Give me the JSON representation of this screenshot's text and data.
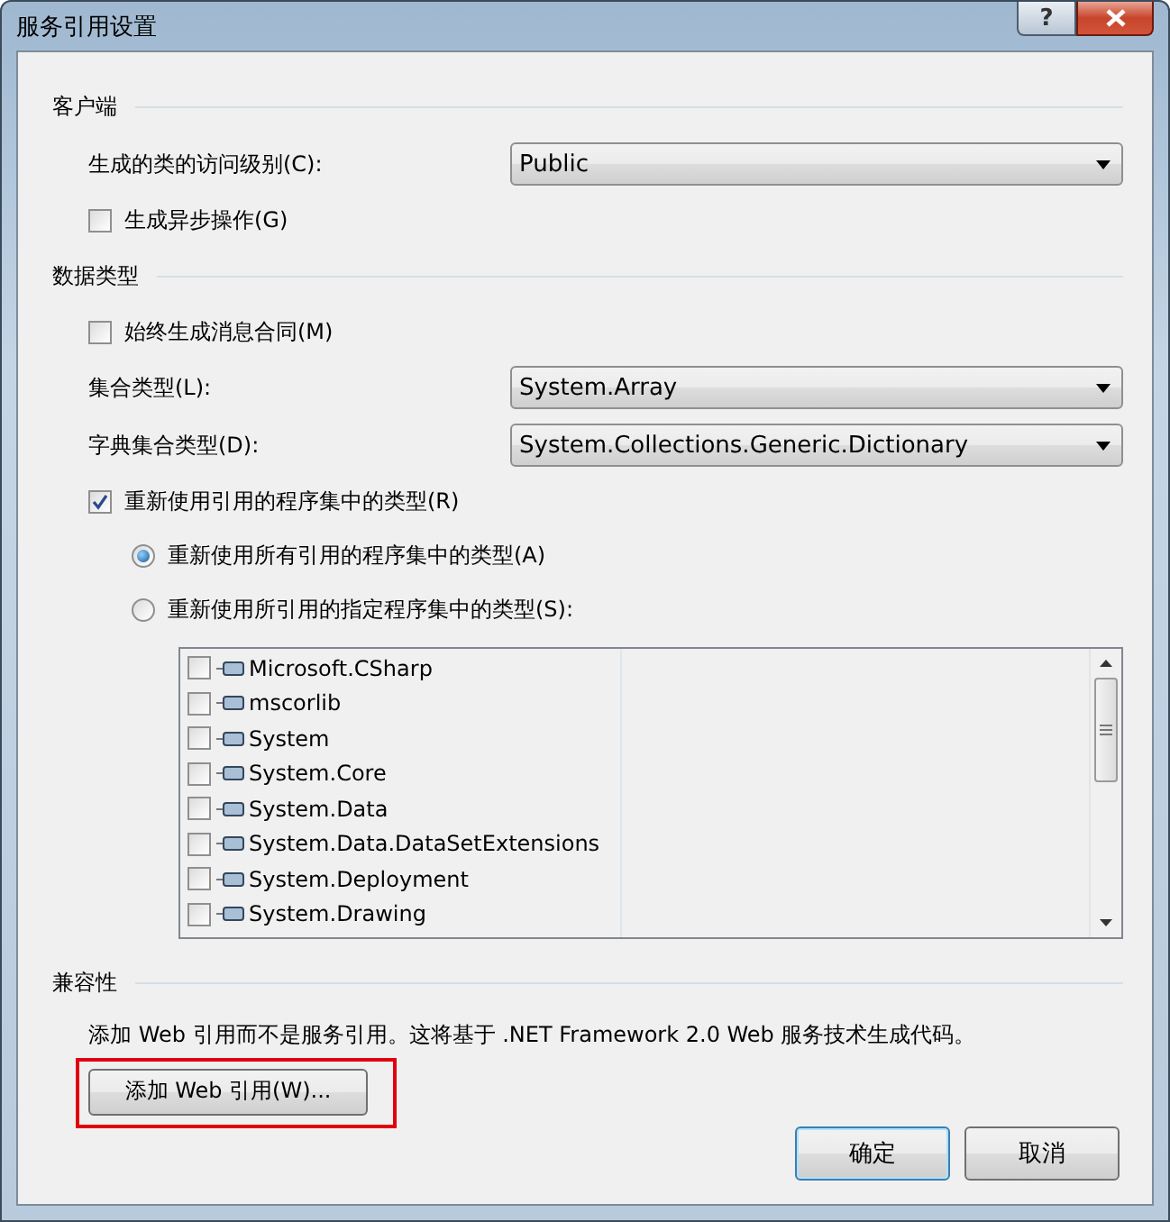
{
  "window": {
    "title": "服务引用设置",
    "help_label": "?"
  },
  "sections": [
    {
      "title": "客户端",
      "rows": [
        {
          "kind": "dropdown",
          "label": "生成的类的访问级别(C):",
          "value": "Public"
        },
        {
          "kind": "checkbox",
          "label": "生成异步操作(G)",
          "checked": false
        }
      ]
    },
    {
      "title": "数据类型",
      "rows": [
        {
          "kind": "checkbox",
          "label": "始终生成消息合同(M)",
          "checked": false
        },
        {
          "kind": "dropdown",
          "label": "集合类型(L):",
          "value": "System.Array"
        },
        {
          "kind": "dropdown",
          "label": "字典集合类型(D):",
          "value": "System.Collections.Generic.Dictionary"
        },
        {
          "kind": "checkbox",
          "label": "重新使用引用的程序集中的类型(R)",
          "checked": true
        },
        {
          "kind": "radio",
          "label": "重新使用所有引用的程序集中的类型(A)",
          "selected": true
        },
        {
          "kind": "radio",
          "label": "重新使用所引用的指定程序集中的类型(S):",
          "selected": false
        },
        {
          "kind": "list",
          "items": [
            {
              "label": "Microsoft.CSharp",
              "checked": false
            },
            {
              "label": "mscorlib",
              "checked": false
            },
            {
              "label": "System",
              "checked": false
            },
            {
              "label": "System.Core",
              "checked": false
            },
            {
              "label": "System.Data",
              "checked": false
            },
            {
              "label": "System.Data.DataSetExtensions",
              "checked": false
            },
            {
              "label": "System.Deployment",
              "checked": false
            },
            {
              "label": "System.Drawing",
              "checked": false
            }
          ]
        }
      ]
    },
    {
      "title": "兼容性",
      "rows": [
        {
          "kind": "text",
          "text": "添加 Web 引用而不是服务引用。这将基于 .NET Framework 2.0 Web 服务技术生成代码。"
        },
        {
          "kind": "button",
          "label": "添加 Web 引用(W)...",
          "highlighted": true
        }
      ]
    }
  ],
  "footer_buttons": [
    {
      "label": "确定",
      "default": true
    },
    {
      "label": "取消",
      "default": false
    }
  ]
}
